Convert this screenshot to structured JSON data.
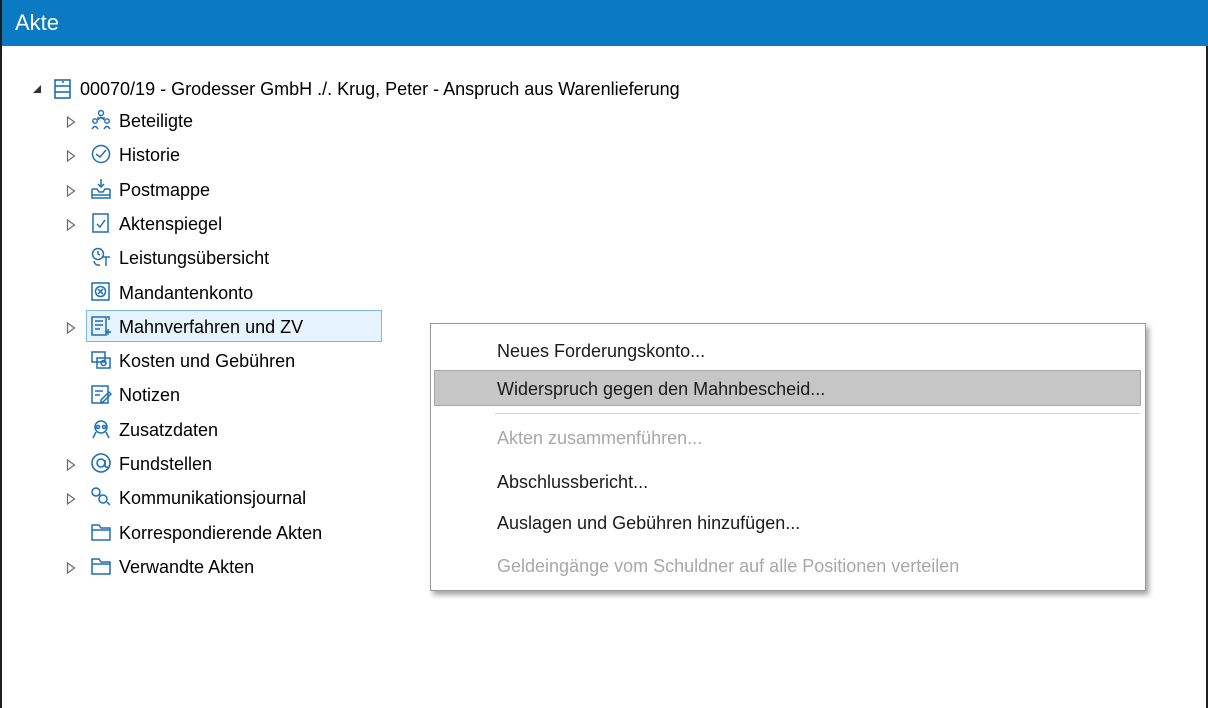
{
  "window": {
    "title": "Akte"
  },
  "tree": {
    "root": {
      "label": "00070/19 - Grodesser GmbH ./. Krug, Peter - Anspruch aus Warenlieferung",
      "icon": "case-file-icon",
      "expanded": true
    },
    "items": [
      {
        "label": "Beteiligte",
        "icon": "participants-icon",
        "expandable": true
      },
      {
        "label": "Historie",
        "icon": "history-icon",
        "expandable": true
      },
      {
        "label": "Postmappe",
        "icon": "mailbox-icon",
        "expandable": true
      },
      {
        "label": "Aktenspiegel",
        "icon": "checklist-doc-icon",
        "expandable": true
      },
      {
        "label": "Leistungsübersicht",
        "icon": "services-icon",
        "expandable": false
      },
      {
        "label": "Mandantenkonto",
        "icon": "account-icon",
        "expandable": false
      },
      {
        "label": "Mahnverfahren und ZV",
        "icon": "dunning-icon",
        "expandable": true,
        "selected": true
      },
      {
        "label": "Kosten und Gebühren",
        "icon": "costs-icon",
        "expandable": false
      },
      {
        "label": "Notizen",
        "icon": "notes-icon",
        "expandable": false
      },
      {
        "label": "Zusatzdaten",
        "icon": "extra-data-icon",
        "expandable": false
      },
      {
        "label": "Fundstellen",
        "icon": "at-sign-icon",
        "expandable": true
      },
      {
        "label": "Kommunikationsjournal",
        "icon": "communication-icon",
        "expandable": true
      },
      {
        "label": "Korrespondierende Akten",
        "icon": "folder-icon",
        "expandable": false
      },
      {
        "label": "Verwandte Akten",
        "icon": "folder-icon",
        "expandable": true
      }
    ]
  },
  "context_menu": {
    "items": [
      {
        "label": "Neues Forderungskonto...",
        "enabled": true
      },
      {
        "label": "Widerspruch gegen den Mahnbescheid...",
        "enabled": true,
        "highlighted": true
      },
      {
        "label": "Akten zusammenführen...",
        "enabled": false
      },
      {
        "label": "Abschlussbericht...",
        "enabled": true
      },
      {
        "label": "Auslagen und Gebühren hinzufügen...",
        "enabled": true
      },
      {
        "label": "Geldeingänge vom Schuldner auf alle Positionen verteilen",
        "enabled": false
      }
    ]
  },
  "colors": {
    "titlebar": "#0a7bc2",
    "selection": "#e6f2fc",
    "menu_highlight": "#c6c6c6",
    "disabled_text": "#a8a8a8"
  }
}
